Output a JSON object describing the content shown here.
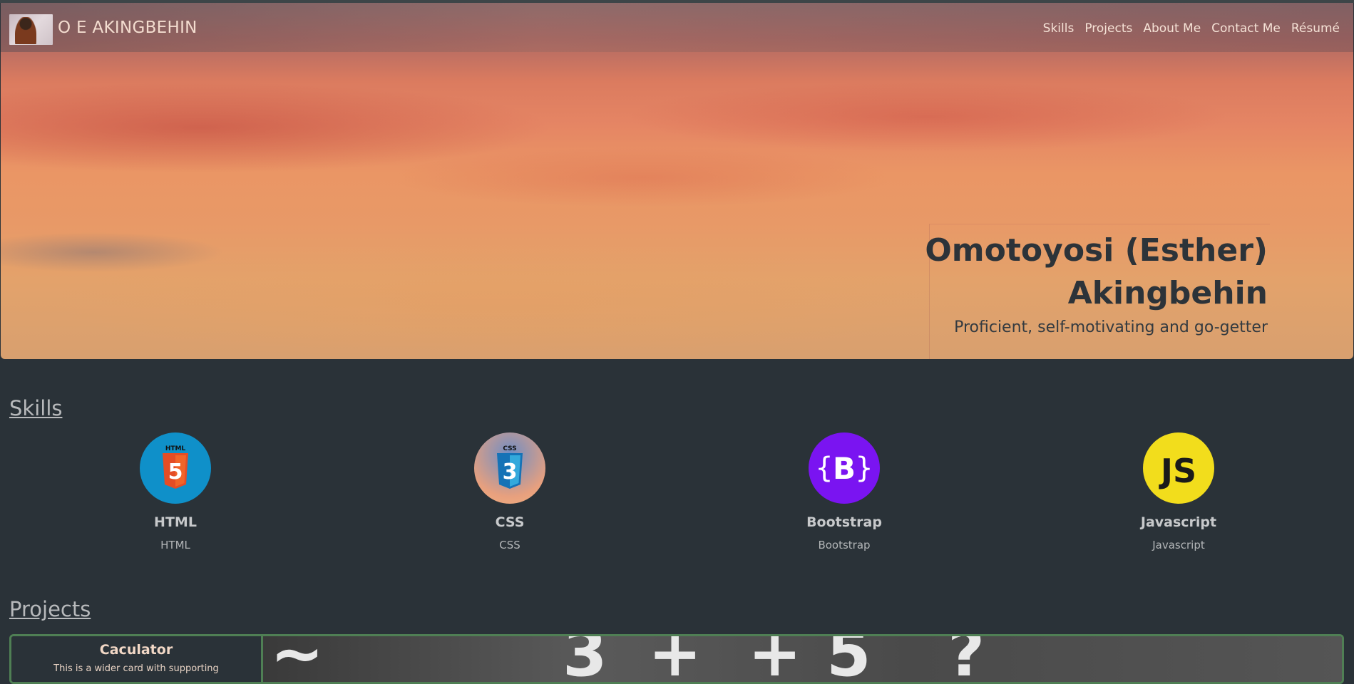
{
  "navbar": {
    "brand": "O E AKINGBEHIN",
    "links": [
      "Skills",
      "Projects",
      "About Me",
      "Contact Me",
      "Résumé"
    ]
  },
  "hero": {
    "title": "Omotoyosi (Esther) Akingbehin",
    "subtitle": "Proficient, self-motivating and go-getter"
  },
  "skills": {
    "heading": "Skills",
    "items": [
      {
        "name": "HTML",
        "desc": "HTML",
        "icon": "html5-icon",
        "color": "#0f90c9"
      },
      {
        "name": "CSS",
        "desc": "CSS",
        "icon": "css3-icon",
        "color": "#6f8ec5"
      },
      {
        "name": "Bootstrap",
        "desc": "Bootstrap",
        "icon": "bootstrap-icon",
        "color": "#7a14f1"
      },
      {
        "name": "Javascript",
        "desc": "Javascript",
        "icon": "javascript-icon",
        "color": "#f2dd1c"
      }
    ]
  },
  "projects": {
    "heading": "Projects",
    "cards": [
      {
        "title": "Caculator",
        "body": "This is a wider card with supporting"
      }
    ]
  },
  "colors": {
    "background": "#2a3238",
    "card_border": "#4f7f54"
  }
}
